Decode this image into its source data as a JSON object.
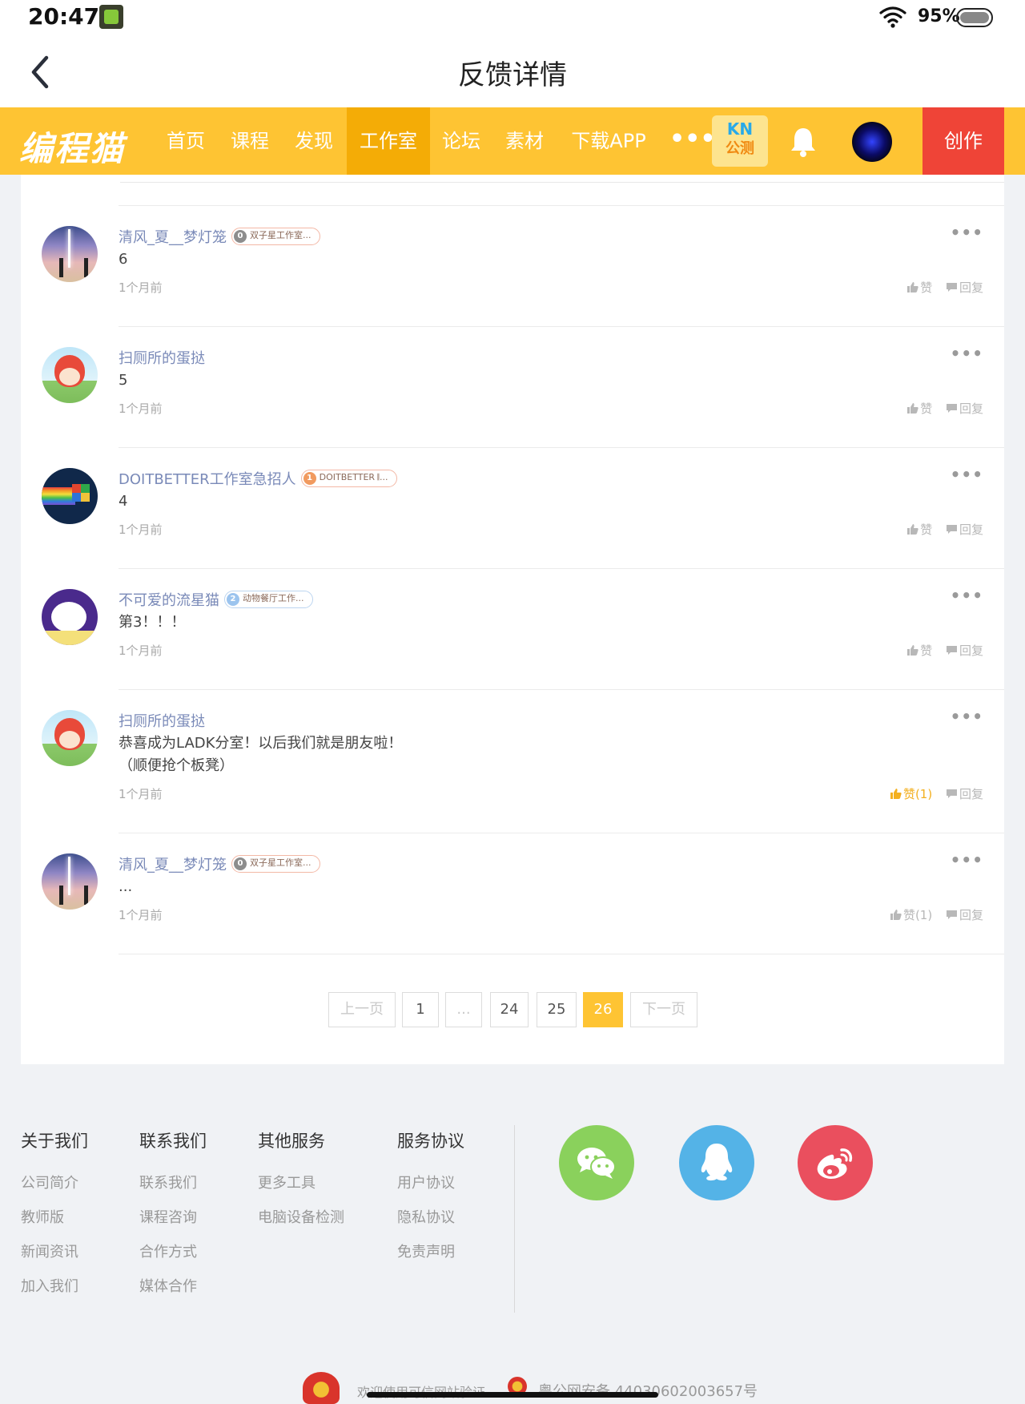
{
  "status_bar": {
    "time": "20:47",
    "battery": "95%"
  },
  "header": {
    "title": "反馈详情"
  },
  "nav": {
    "logo": "编程猫",
    "items": [
      "首页",
      "课程",
      "发现",
      "工作室",
      "论坛",
      "素材",
      "下载APP"
    ],
    "active_index": 3,
    "more": "•••",
    "kn_top": "KN",
    "kn_bottom": "公测",
    "create": "创作"
  },
  "comments": [
    {
      "user": "清风_夏__梦灯笼",
      "badge_level": "0",
      "badge_text": "双子星工作室...",
      "text": "6",
      "time": "1个月前",
      "like_label": "赞",
      "reply_label": "回复",
      "liked": false
    },
    {
      "user": "扫厕所的蛋挞",
      "badge_level": "",
      "badge_text": "",
      "text": "5",
      "time": "1个月前",
      "like_label": "赞",
      "reply_label": "回复",
      "liked": false
    },
    {
      "user": "DOITBETTER工作室急招人",
      "badge_level": "1",
      "badge_text": "DOITBETTER 𝄃...",
      "text": "4",
      "time": "1个月前",
      "like_label": "赞",
      "reply_label": "回复",
      "liked": false
    },
    {
      "user": "不可爱的流星猫",
      "badge_level": "2",
      "badge_text": "动物餐厅工作...",
      "text": "第3！！！",
      "time": "1个月前",
      "like_label": "赞",
      "reply_label": "回复",
      "liked": false
    },
    {
      "user": "扫厕所的蛋挞",
      "badge_level": "",
      "badge_text": "",
      "text": "恭喜成为LADK分室！以后我们就是朋友啦！\n（顺便抢个板凳）",
      "time": "1个月前",
      "like_label": "赞(1)",
      "reply_label": "回复",
      "liked": true
    },
    {
      "user": "清风_夏__梦灯笼",
      "badge_level": "0",
      "badge_text": "双子星工作室...",
      "text": "...",
      "time": "1个月前",
      "like_label": "赞(1)",
      "reply_label": "回复",
      "liked": false
    }
  ],
  "more_label": "•••",
  "pagination": {
    "prev": "上一页",
    "pages": [
      "1",
      "...",
      "24",
      "25",
      "26"
    ],
    "current": "26",
    "next": "下一页"
  },
  "footer": {
    "columns": [
      {
        "title": "关于我们",
        "links": [
          "公司简介",
          "教师版",
          "新闻资讯",
          "加入我们"
        ]
      },
      {
        "title": "联系我们",
        "links": [
          "联系我们",
          "课程咨询",
          "合作方式",
          "媒体合作"
        ]
      },
      {
        "title": "其他服务",
        "links": [
          "更多工具",
          "电脑设备检测"
        ]
      },
      {
        "title": "服务协议",
        "links": [
          "用户协议",
          "隐私协议",
          "免责声明"
        ]
      }
    ],
    "social": [
      "wechat-icon",
      "qq-icon",
      "weibo-icon"
    ],
    "verify_text": "欢迎使用可信网站验证",
    "icp": "粤公网安备 44030602003657号"
  },
  "colors": {
    "brand": "#fec433",
    "brand_active": "#f4ac06",
    "create": "#ef4437",
    "link": "#7a8ab8",
    "liked": "#f3b020"
  }
}
